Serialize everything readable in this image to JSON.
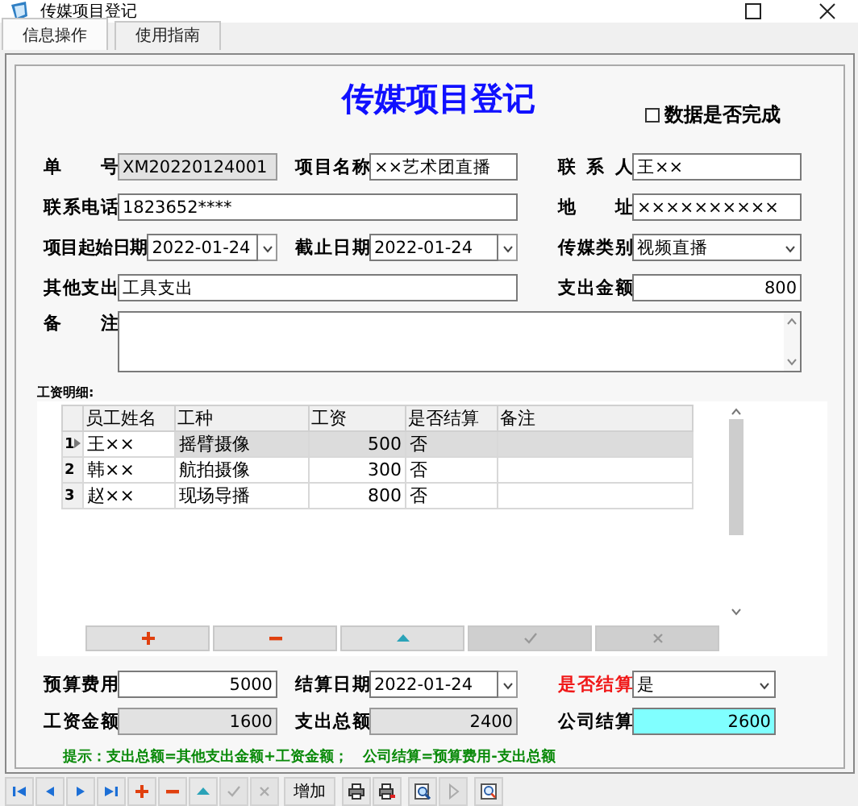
{
  "window": {
    "title": "传媒项目登记"
  },
  "tabs": [
    {
      "label": "信息操作",
      "selected": true
    },
    {
      "label": "使用指南",
      "selected": false
    }
  ],
  "form": {
    "heading": "传媒项目登记",
    "complete_checkbox": {
      "label": "数据是否完成",
      "checked": false
    },
    "rows": [
      [
        {
          "label": "单 号",
          "value": "XM20220124001",
          "kind": "readonly"
        },
        {
          "label": "项目名称",
          "value": "××艺术团直播",
          "kind": "text"
        },
        {
          "label": "联 系 人",
          "value": "王××",
          "kind": "text"
        }
      ],
      [
        {
          "label": "联系电话",
          "value": "1823652****",
          "kind": "text"
        },
        {
          "label": "地 址",
          "value": "××××××××××",
          "kind": "text"
        }
      ],
      [
        {
          "label": "项目起始日期",
          "value": "2022-01-24",
          "kind": "date"
        },
        {
          "label": "截止日期",
          "value": "2022-01-24",
          "kind": "date"
        },
        {
          "label": "传媒类别",
          "value": "视频直播",
          "kind": "combo"
        }
      ],
      [
        {
          "label": "其他支出",
          "value": "工具支出",
          "kind": "text"
        },
        {
          "label": "支出金额",
          "value": "800",
          "kind": "number"
        }
      ],
      [
        {
          "label": "备 注",
          "kind": "memo"
        }
      ]
    ]
  },
  "wages": {
    "label": "工资明细:",
    "columns": [
      "员工姓名",
      "工种",
      "工资",
      "是否结算",
      "备注"
    ],
    "rows": [
      {
        "number": "1",
        "selected": true,
        "cells": [
          "王××",
          "摇臂摄像",
          "500",
          "否"
        ]
      },
      {
        "number": "2",
        "selected": false,
        "cells": [
          "韩××",
          "航拍摄像",
          "300",
          "否"
        ]
      },
      {
        "number": "3",
        "selected": false,
        "cells": [
          "赵××",
          "现场导播",
          "800",
          "否"
        ]
      }
    ],
    "buttons": [
      {
        "kind": "add",
        "disabled": false
      },
      {
        "kind": "delete",
        "disabled": false
      },
      {
        "kind": "up",
        "disabled": false
      },
      {
        "kind": "confirm",
        "disabled": true
      },
      {
        "kind": "cancel",
        "disabled": true
      }
    ]
  },
  "totals": {
    "rows": [
      [
        {
          "label": "预算费用",
          "value": "5000",
          "kind": "number",
          "emphasis": false
        },
        {
          "label": "结算日期",
          "value": "2022-01-24",
          "kind": "date",
          "emphasis": false
        },
        {
          "label": "是否结算",
          "value": "是",
          "kind": "combo",
          "emphasis": true
        }
      ],
      [
        {
          "label": "工资金额",
          "value": "1600",
          "kind": "computed",
          "emphasis": false
        },
        {
          "label": "支出总额",
          "value": "2400",
          "kind": "computed",
          "emphasis": false
        },
        {
          "label": "公司结算",
          "value": "2600",
          "kind": "highlight",
          "emphasis": false
        }
      ]
    ],
    "hint": "提示：支出总额=其他支出金额+工资金额；　公司结算=预算费用-支出总额"
  },
  "toolbar": [
    {
      "kind": "first",
      "disabled": false
    },
    {
      "kind": "prev",
      "disabled": false
    },
    {
      "kind": "next",
      "disabled": false
    },
    {
      "kind": "last",
      "disabled": false
    },
    {
      "kind": "add",
      "disabled": false
    },
    {
      "kind": "delete",
      "disabled": false
    },
    {
      "kind": "up",
      "disabled": false
    },
    {
      "kind": "confirm",
      "disabled": true
    },
    {
      "kind": "cancel",
      "disabled": true
    },
    {
      "kind": "text",
      "label": "增加",
      "disabled": false
    },
    {
      "kind": "print",
      "disabled": false
    },
    {
      "kind": "print-export",
      "disabled": false
    },
    {
      "kind": "preview",
      "disabled": false
    },
    {
      "kind": "play",
      "disabled": true
    },
    {
      "kind": "zoom",
      "disabled": false
    }
  ]
}
